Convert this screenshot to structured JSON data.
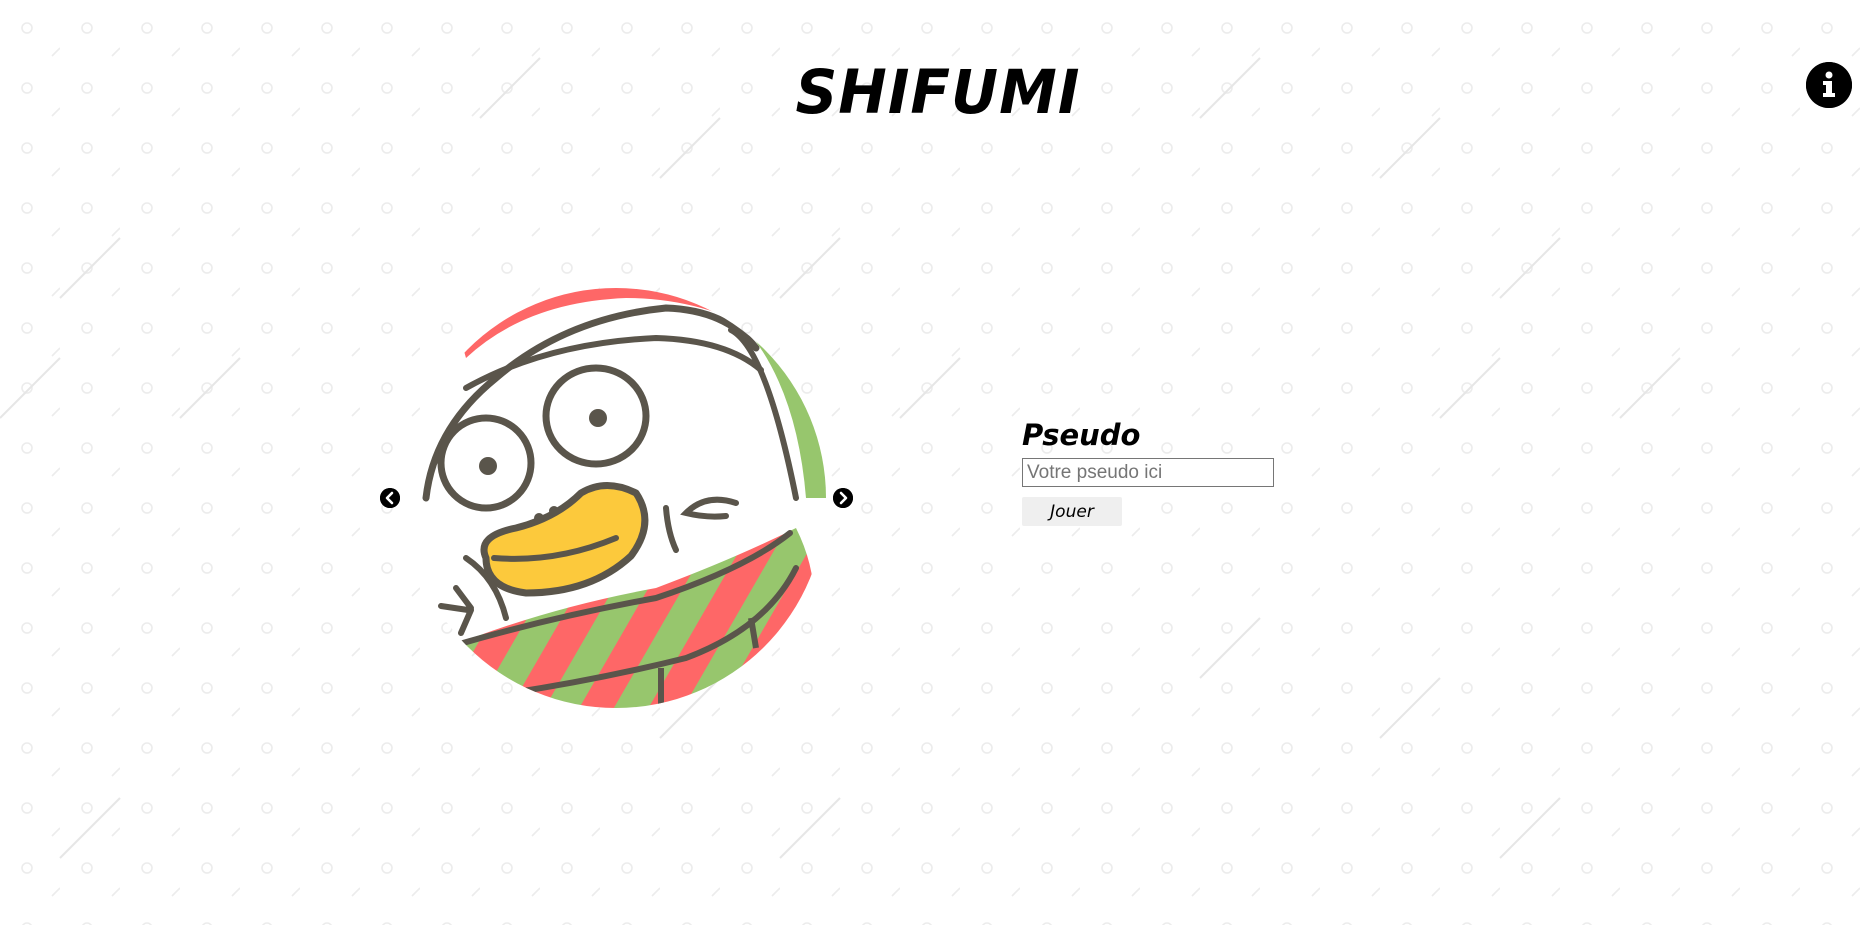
{
  "app": {
    "title": "SHIFUMI"
  },
  "header": {
    "info_icon": "info-circle-icon"
  },
  "carousel": {
    "image_description_icon": "duck-avatar",
    "prev_icon": "chevron-left-circle-icon",
    "next_icon": "chevron-right-circle-icon"
  },
  "form": {
    "label": "Pseudo",
    "input_placeholder": "Votre pseudo ici",
    "input_value": "",
    "play_button_label": "Jouer"
  },
  "colors": {
    "background": "#ffffff",
    "pattern": "#ececec",
    "text": "#000000",
    "duck_outline": "#5a554b",
    "duck_beak": "#fcc93c",
    "stripe_red": "#fe6767",
    "stripe_green": "#97c66d",
    "button_bg": "#efefef"
  }
}
